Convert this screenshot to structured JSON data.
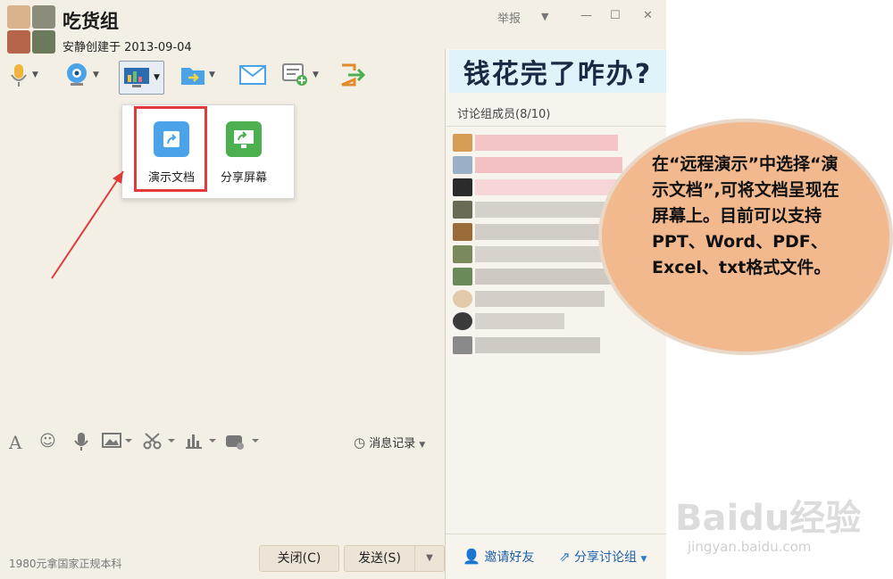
{
  "window": {
    "title": "吃货组",
    "subtitle": "安静创建于 2013-09-04",
    "report": "举报",
    "minimize_icon": "—",
    "maximize_icon": "☐",
    "close_icon": "✕"
  },
  "toolbar": {
    "icons": [
      "microphone-icon",
      "camera-icon",
      "screen-share-icon",
      "file-transfer-icon",
      "mail-icon",
      "add-app-icon",
      "exit-icon"
    ]
  },
  "popup": {
    "item1_label": "演示文档",
    "item2_label": "分享屏幕"
  },
  "banner": {
    "text": "钱花完了咋办?"
  },
  "members": {
    "header": "讨论组成员(8/10)"
  },
  "bottom_toolbar": {
    "history_label": "消息记录"
  },
  "footer": {
    "company": "1980元拿国家正规本科",
    "close_button": "关闭(C)",
    "send_button": "发送(S)",
    "invite": "邀请好友",
    "share_group": "分享讨论组"
  },
  "callout": {
    "text": "在“远程演示”中选择“演示文档”,可将文档呈现在屏幕上。目前可以支持PPT、Word、PDF、Excel、txt格式文件。"
  },
  "watermark": {
    "logo": "Baidu经验",
    "url": "jingyan.baidu.com"
  },
  "colors": {
    "accent_blue": "#4aa3e8",
    "accent_green": "#4caf50",
    "highlight_red": "#e03a3a",
    "callout_fill": "#f2b88e"
  }
}
